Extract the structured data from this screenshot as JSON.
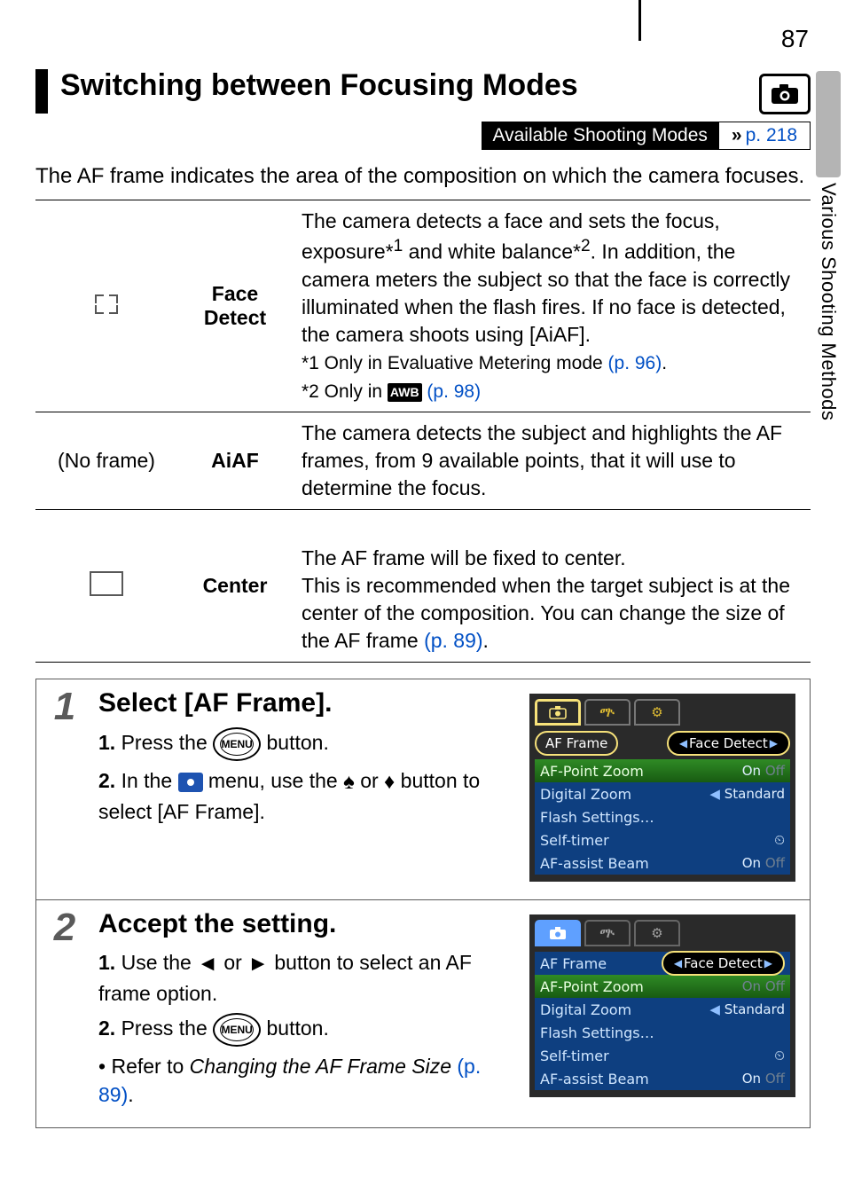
{
  "page_number": "87",
  "side_label": "Various Shooting Methods",
  "title": "Switching between Focusing Modes",
  "modes_bar": {
    "label": "Available Shooting Modes",
    "link": "p. 218"
  },
  "intro": "The AF frame indicates the area of the composition on which the camera focuses.",
  "table": {
    "rows": [
      {
        "icon_name": "face-detect-corners",
        "mode": "Face Detect",
        "desc_pre": "The camera detects a face and sets the focus, exposure*",
        "sup1": "1",
        "desc_mid": " and white balance*",
        "sup2": "2",
        "desc_post": ". In addition, the camera meters the subject so that the face is correctly illuminated when the flash fires. If no face is detected, the camera shoots using [AiAF].",
        "note1": "*1 Only in Evaluative Metering mode ",
        "note1_link": "(p. 96)",
        "note1_after": ".",
        "note2_pre": "*2 Only in ",
        "note2_icon": "AWB",
        "note2_link": " (p. 98)"
      },
      {
        "icon_name": "no-frame",
        "icon_text": "(No frame)",
        "mode": "AiAF",
        "desc": "The camera detects the subject and highlights the AF frames, from 9 available points, that it will use to determine the focus."
      },
      {
        "icon_name": "center-frame",
        "mode": "Center",
        "desc_pre": "The AF frame will be fixed to center.\nThis is recommended when the target subject is at the center of the composition. You can change the size of the AF frame ",
        "desc_link": "(p. 89)",
        "desc_after": "."
      }
    ]
  },
  "steps": [
    {
      "num": "1",
      "title": "Select [AF Frame].",
      "items": [
        {
          "n": "1.",
          "pre": "Press the ",
          "btn": "MENU",
          "post": " button."
        },
        {
          "n": "2.",
          "pre": "In the ",
          "menu_icon": true,
          "mid": " menu, use the ",
          "arrows": "ud",
          "post": " button to select [AF Frame]."
        }
      ],
      "lcd": {
        "variant": "v1",
        "tab_icons": [
          "camera",
          "tools",
          "settings"
        ],
        "rows": [
          {
            "key": "AF Frame",
            "value": "Face Detect",
            "style": "key-pill"
          },
          {
            "key": "AF-Point Zoom",
            "value_on": "On",
            "value_off": "Off",
            "style": "grn"
          },
          {
            "key": "Digital Zoom",
            "value": "Standard",
            "style": "blue",
            "chev": "l"
          },
          {
            "key": "Flash Settings…",
            "value": "",
            "style": "blue"
          },
          {
            "key": "Self-timer",
            "value_icon": "timer",
            "style": "blue"
          },
          {
            "key": "AF-assist Beam",
            "value_on": "On",
            "value_off": "Off",
            "style": "blue"
          }
        ]
      }
    },
    {
      "num": "2",
      "title": "Accept the setting.",
      "items": [
        {
          "n": "1.",
          "pre": "Use the ",
          "arrows": "lr",
          "post": " button to select an AF frame option."
        },
        {
          "n": "2.",
          "pre": "Press the ",
          "btn": "MENU",
          "post": " button."
        }
      ],
      "bullet": {
        "pre": "Refer to ",
        "ital": "Changing the AF Frame Size",
        "link": " (p. 89)",
        "after": "."
      },
      "lcd": {
        "variant": "v2",
        "tab_icons": [
          "camera",
          "tools",
          "settings"
        ],
        "rows": [
          {
            "key": "AF Frame",
            "value": "Face Detect",
            "style": "pill"
          },
          {
            "key": "AF-Point Zoom",
            "value_on": "On",
            "value_off": "Off",
            "style": "grn",
            "muted_on": true
          },
          {
            "key": "Digital Zoom",
            "value": "Standard",
            "style": "blue",
            "chev": "l"
          },
          {
            "key": "Flash Settings…",
            "value": "",
            "style": "blue"
          },
          {
            "key": "Self-timer",
            "value_icon": "timer",
            "style": "blue"
          },
          {
            "key": "AF-assist Beam",
            "value_on": "On",
            "value_off": "Off",
            "style": "blue"
          }
        ]
      }
    }
  ]
}
